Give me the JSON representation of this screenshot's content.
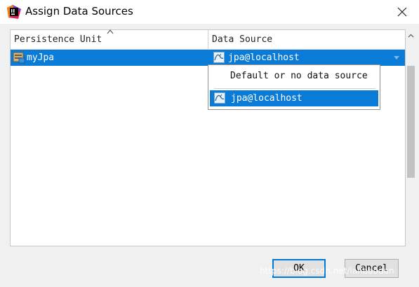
{
  "window": {
    "title": "Assign Data Sources",
    "app_icon": "intellij-idea-icon",
    "close_icon": "close-icon"
  },
  "table": {
    "columns": [
      "Persistence Unit",
      "Data Source"
    ],
    "sort_indicator": "sort-ascending-icon",
    "rows": [
      {
        "persistence_unit": "myJpa",
        "data_source": "jpa@localhost",
        "selected": true
      }
    ]
  },
  "dropdown": {
    "options": [
      "Default or no data source",
      "jpa@localhost"
    ],
    "selected": "jpa@localhost"
  },
  "buttons": {
    "ok": "OK",
    "cancel": "Cancel"
  },
  "watermark": "https://blog.csdn.net/lanbaodan",
  "colors": {
    "selection": "#0a7bd7",
    "ok_border": "#0078d7"
  }
}
